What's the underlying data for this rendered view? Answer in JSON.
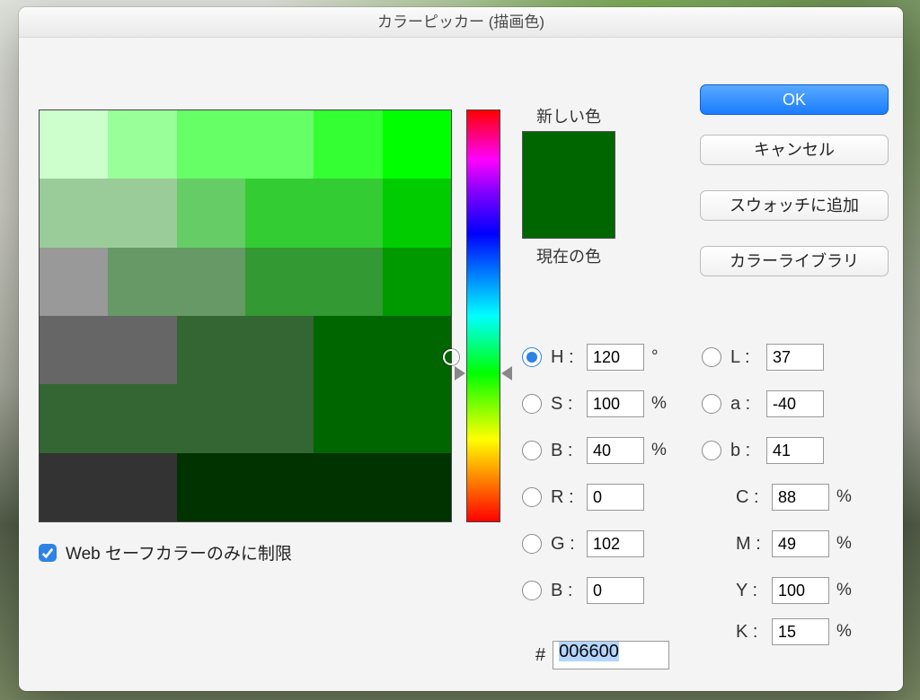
{
  "title": "カラーピッカー (描画色)",
  "buttons": {
    "ok": "OK",
    "cancel": "キャンセル",
    "add_swatch": "スウォッチに追加",
    "library": "カラーライブラリ"
  },
  "swatch": {
    "new_label": "新しい色",
    "current_label": "現在の色",
    "new_color": "#006600",
    "current_color": "#006600"
  },
  "websafe_label": "Web セーフカラーのみに制限",
  "websafe_checked": true,
  "radio_selected": "H",
  "hsb": {
    "h": {
      "label": "H :",
      "value": "120",
      "unit": "°"
    },
    "s": {
      "label": "S :",
      "value": "100",
      "unit": "%"
    },
    "b": {
      "label": "B :",
      "value": "40",
      "unit": "%"
    }
  },
  "rgb": {
    "r": {
      "label": "R :",
      "value": "0"
    },
    "g": {
      "label": "G :",
      "value": "102"
    },
    "b": {
      "label": "B :",
      "value": "0"
    }
  },
  "lab": {
    "l": {
      "label": "L :",
      "value": "37"
    },
    "a": {
      "label": "a :",
      "value": "-40"
    },
    "b": {
      "label": "b :",
      "value": "41"
    }
  },
  "cmyk": {
    "c": {
      "label": "C :",
      "value": "88",
      "unit": "%"
    },
    "m": {
      "label": "M :",
      "value": "49",
      "unit": "%"
    },
    "y": {
      "label": "Y :",
      "value": "100",
      "unit": "%"
    },
    "k": {
      "label": "K :",
      "value": "15",
      "unit": "%"
    }
  },
  "hex": "006600",
  "hue_base": "#00ff00",
  "hue_pos_pct": 64,
  "sb_cursor": {
    "x_pct": 100,
    "y_pct": 60
  }
}
